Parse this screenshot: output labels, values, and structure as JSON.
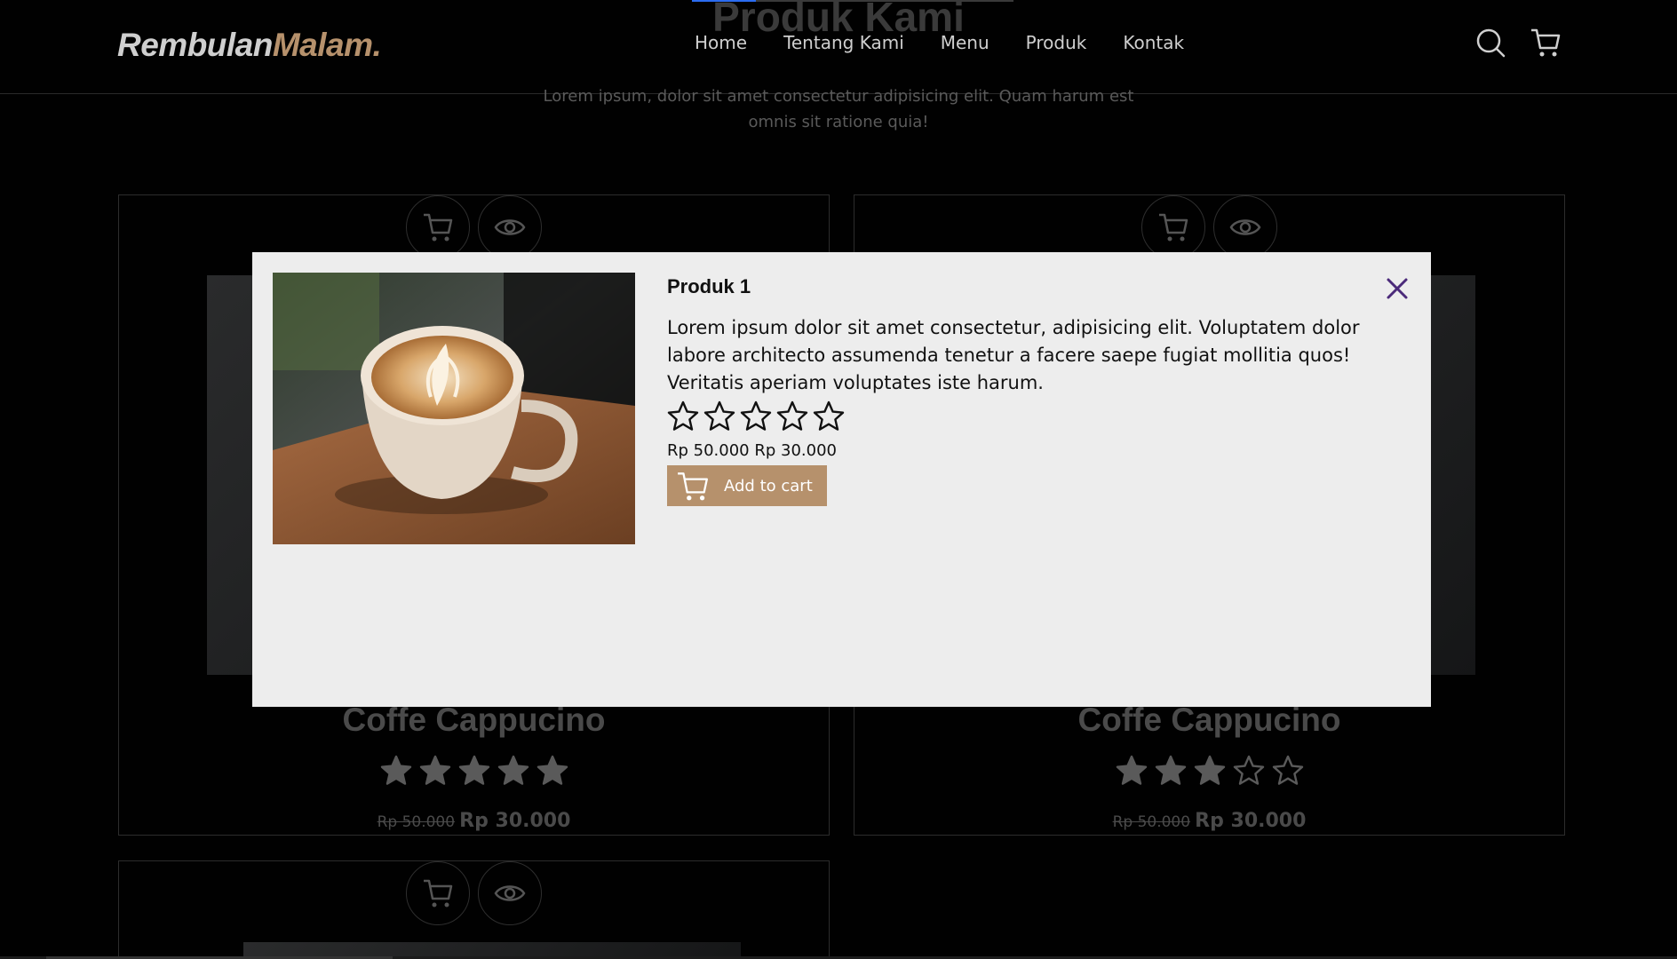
{
  "navbar": {
    "logo_part1": "Rembulan",
    "logo_part2": "Malam.",
    "links": [
      "Home",
      "Tentang Kami",
      "Menu",
      "Produk",
      "Kontak"
    ],
    "icons": [
      "search-icon",
      "shopping-cart-icon"
    ]
  },
  "section": {
    "title": "Produk Kami",
    "subtitle": "Lorem ipsum, dolor sit amet consectetur adipisicing elit. Quam harum est omnis sit ratione quia!"
  },
  "cards": [
    {
      "name": "Coffe Cappucino",
      "rating": 5,
      "old_price": "Rp 50.000",
      "new_price": "Rp 30.000"
    },
    {
      "name": "Coffe Cappucino",
      "rating": 3,
      "old_price": "Rp 50.000",
      "new_price": "Rp 30.000"
    }
  ],
  "modal": {
    "title": "Produk 1",
    "description": "Lorem ipsum dolor sit amet consectetur, adipisicing elit. Voluptatem dolor labore architecto assumenda tenetur a facere saepe fugiat mollitia quos! Veritatis aperiam voluptates iste harum.",
    "rating": 0,
    "price_text": "Rp 50.000 Rp 30.000",
    "add_to_cart_label": "Add to cart"
  },
  "colors": {
    "accent": "#b6916c",
    "modal_bg": "#ededed",
    "close_icon": "#4b2a7a",
    "page_bg": "#010101"
  }
}
